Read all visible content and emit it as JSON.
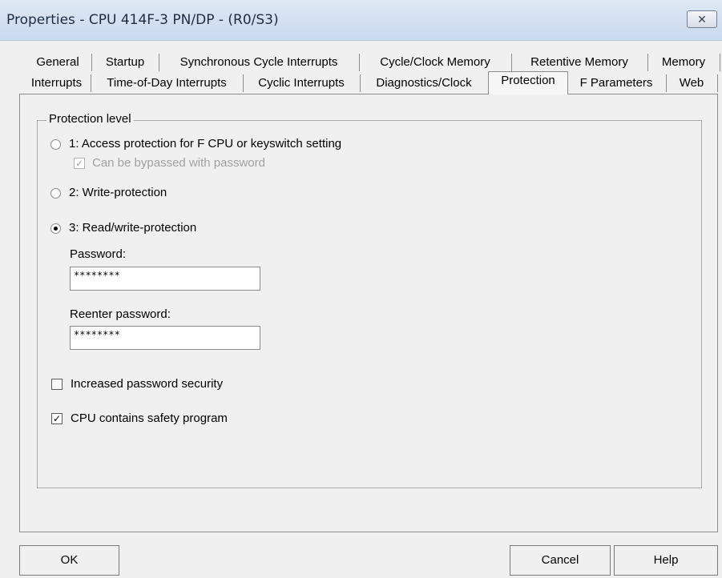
{
  "window": {
    "title": "Properties - CPU 414F-3 PN/DP - (R0/S3)",
    "close_glyph": "✕"
  },
  "tabs": {
    "row1": [
      "General",
      "Startup",
      "Synchronous Cycle Interrupts",
      "Cycle/Clock Memory",
      "Retentive Memory",
      "Memory"
    ],
    "row2": [
      "Interrupts",
      "Time-of-Day Interrupts",
      "Cyclic Interrupts",
      "Diagnostics/Clock",
      "Protection",
      "F Parameters",
      "Web"
    ],
    "active": "Protection"
  },
  "protection": {
    "group_label": "Protection level",
    "option1": "1: Access protection for  F CPU or keyswitch setting",
    "option1_bypass": "Can be bypassed with password",
    "option2": "2: Write-protection",
    "option3": "3: Read/write-protection",
    "selected_option": 3,
    "password_label": "Password:",
    "password_value": "********",
    "reenter_label": "Reenter password:",
    "reenter_value": "********",
    "increased_security": "Increased password security",
    "increased_security_checked": false,
    "safety_program": "CPU contains safety program",
    "safety_program_checked": true,
    "bypass_checked": true
  },
  "buttons": {
    "ok": "OK",
    "cancel": "Cancel",
    "help": "Help"
  }
}
